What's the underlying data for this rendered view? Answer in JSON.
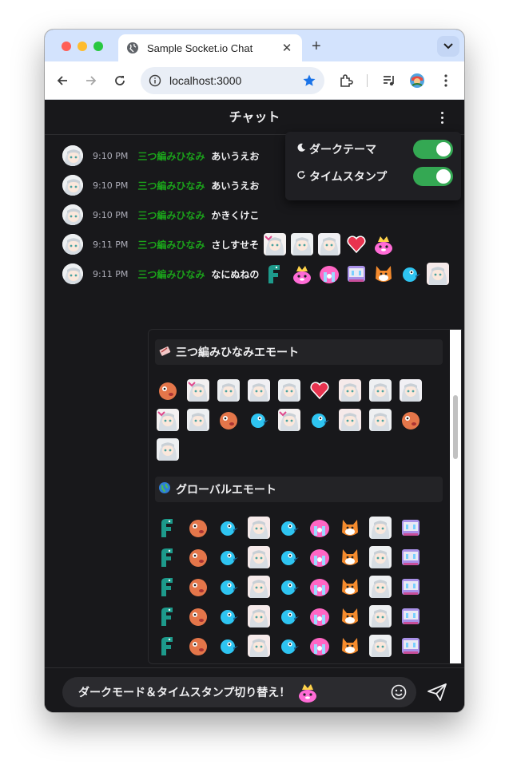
{
  "browser": {
    "tab_title": "Sample Socket.io Chat",
    "new_tab_label": "+",
    "close_label": "✕",
    "url": "localhost:3000"
  },
  "app": {
    "title": "チャット",
    "settings": {
      "dark_theme_label": "ダークテーマ",
      "dark_theme_on": true,
      "timestamp_label": "タイムスタンプ",
      "timestamp_on": true
    },
    "messages": [
      {
        "time": "9:10 PM",
        "user": "三つ編みひなみ",
        "text": "あいうえお",
        "emotes": []
      },
      {
        "time": "9:10 PM",
        "user": "三つ編みひなみ",
        "text": "あいうえお",
        "emotes": []
      },
      {
        "time": "9:10 PM",
        "user": "三つ編みひなみ",
        "text": "かきくけこ",
        "emotes": []
      },
      {
        "time": "9:11 PM",
        "user": "三つ編みひなみ",
        "text": "さしすせそ",
        "emotes": [
          "girl-heart-emote",
          "girl-emote",
          "girl-wink-emote",
          "heart-emote",
          "pink-crown-emote"
        ]
      },
      {
        "time": "9:11 PM",
        "user": "三つ編みひなみ",
        "text": "なにぬねの",
        "emotes": [
          "green-dino-emote",
          "pink-crown-emote",
          "pink-cry-emote",
          "robot-cry-emote",
          "orange-dog-emote",
          "blue-bird-emote",
          "girl-angry-emote"
        ]
      }
    ],
    "picker": {
      "sections": [
        {
          "icon": "ribbon-icon",
          "title": "三つ編みひなみエモート",
          "emote_count": 19
        },
        {
          "icon": "globe-icon",
          "title": "グローバルエモート",
          "emote_count": 45
        }
      ]
    },
    "input": {
      "value": "ダークモード＆タイムスタンプ切り替え！",
      "emote": "pink-crown-emote"
    }
  },
  "colors": {
    "username": "#1ba31b",
    "toggle_on": "#34a853",
    "background": "#18181b",
    "tabstrip": "#d3e3fd",
    "star": "#1a73e8"
  }
}
